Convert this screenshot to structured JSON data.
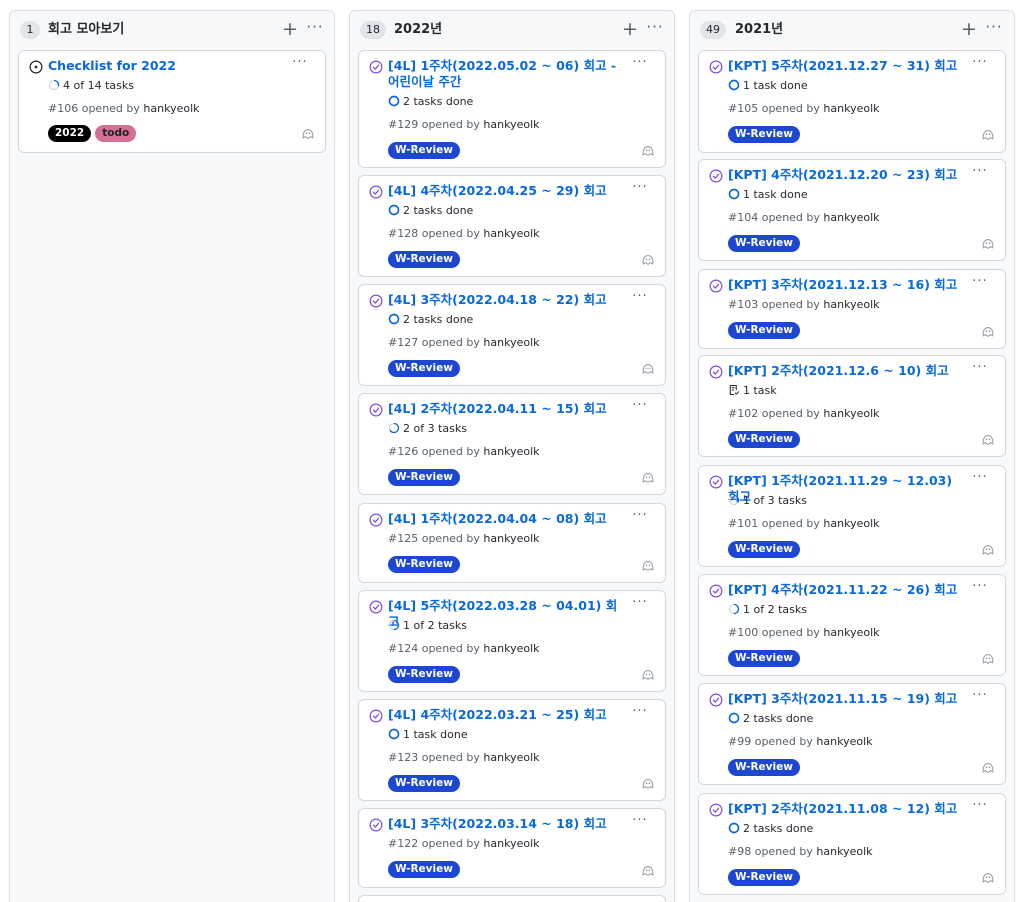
{
  "columns": [
    {
      "count": "1",
      "title": "회고 모아보기",
      "cards": [
        {
          "state": "open",
          "title": "Checklist for 2022",
          "task": "4 of 14 tasks",
          "task_icon": "progress-ring-icon",
          "progress": 0.29,
          "opened": "#106 opened by",
          "author": "hankyeolk",
          "labels": [
            "2022",
            "todo"
          ]
        }
      ]
    },
    {
      "count": "18",
      "title": "2022년",
      "cards": [
        {
          "state": "closed",
          "title": "[4L] 1주차(2022.05.02 ~ 06) 회고 - 어린이날 주간",
          "task": "2 tasks done",
          "task_icon": "done-circle-icon",
          "progress": 1,
          "opened": "#129 opened by",
          "author": "hankyeolk",
          "labels": [
            "W-Review"
          ]
        },
        {
          "state": "closed",
          "title": "[4L] 4주차(2022.04.25 ~ 29) 회고",
          "task": "2 tasks done",
          "task_icon": "done-circle-icon",
          "progress": 1,
          "opened": "#128 opened by",
          "author": "hankyeolk",
          "labels": [
            "W-Review"
          ]
        },
        {
          "state": "closed",
          "title": "[4L] 3주차(2022.04.18 ~ 22) 회고",
          "task": "2 tasks done",
          "task_icon": "done-circle-icon",
          "progress": 1,
          "opened": "#127 opened by",
          "author": "hankyeolk",
          "labels": [
            "W-Review"
          ]
        },
        {
          "state": "closed",
          "title": "[4L] 2주차(2022.04.11 ~ 15) 회고",
          "task": "2 of 3 tasks",
          "task_icon": "progress-ring-icon",
          "progress": 0.67,
          "opened": "#126 opened by",
          "author": "hankyeolk",
          "labels": [
            "W-Review"
          ]
        },
        {
          "state": "closed",
          "title": "[4L] 1주차(2022.04.04 ~ 08) 회고",
          "task": "",
          "task_icon": "",
          "progress": 0,
          "opened": "#125 opened by",
          "author": "hankyeolk",
          "labels": [
            "W-Review"
          ]
        },
        {
          "state": "closed",
          "title": "[4L] 5주차(2022.03.28 ~ 04.01) 회고",
          "task": "1 of 2 tasks",
          "task_icon": "progress-ring-icon",
          "progress": 0.5,
          "opened": "#124 opened by",
          "author": "hankyeolk",
          "labels": [
            "W-Review"
          ]
        },
        {
          "state": "closed",
          "title": "[4L] 4주차(2022.03.21 ~ 25) 회고",
          "task": "1 task done",
          "task_icon": "done-circle-icon",
          "progress": 1,
          "opened": "#123 opened by",
          "author": "hankyeolk",
          "labels": [
            "W-Review"
          ]
        },
        {
          "state": "closed",
          "title": "[4L] 3주차(2022.03.14 ~ 18) 회고",
          "task": "",
          "task_icon": "",
          "progress": 0,
          "opened": "#122 opened by",
          "author": "hankyeolk",
          "labels": [
            "W-Review"
          ]
        }
      ]
    },
    {
      "count": "49",
      "title": "2021년",
      "cards": [
        {
          "state": "closed",
          "title": "[KPT] 5주차(2021.12.27 ~ 31) 회고",
          "task": "1 task done",
          "task_icon": "done-circle-icon",
          "progress": 1,
          "opened": "#105 opened by",
          "author": "hankyeolk",
          "labels": [
            "W-Review"
          ]
        },
        {
          "state": "closed",
          "title": "[KPT] 4주차(2021.12.20 ~ 23) 회고",
          "task": "1 task done",
          "task_icon": "done-circle-icon",
          "progress": 1,
          "opened": "#104 opened by",
          "author": "hankyeolk",
          "labels": [
            "W-Review"
          ]
        },
        {
          "state": "closed",
          "title": "[KPT] 3주차(2021.12.13 ~ 16) 회고",
          "task": "",
          "task_icon": "",
          "progress": 0,
          "opened": "#103 opened by",
          "author": "hankyeolk",
          "labels": [
            "W-Review"
          ]
        },
        {
          "state": "closed",
          "title": "[KPT] 2주차(2021.12.6 ~ 10) 회고",
          "task": "1 task",
          "task_icon": "checklist-icon",
          "progress": 0,
          "opened": "#102 opened by",
          "author": "hankyeolk",
          "labels": [
            "W-Review"
          ]
        },
        {
          "state": "closed",
          "title": "[KPT] 1주차(2021.11.29 ~ 12.03) 회고",
          "task": "1 of 3 tasks",
          "task_icon": "progress-ring-icon",
          "progress": 0.33,
          "opened": "#101 opened by",
          "author": "hankyeolk",
          "labels": [
            "W-Review"
          ]
        },
        {
          "state": "closed",
          "title": "[KPT] 4주차(2021.11.22 ~ 26) 회고",
          "task": "1 of 2 tasks",
          "task_icon": "progress-ring-icon",
          "progress": 0.5,
          "opened": "#100 opened by",
          "author": "hankyeolk",
          "labels": [
            "W-Review"
          ]
        },
        {
          "state": "closed",
          "title": "[KPT] 3주차(2021.11.15 ~ 19) 회고",
          "task": "2 tasks done",
          "task_icon": "done-circle-icon",
          "progress": 1,
          "opened": "#99 opened by",
          "author": "hankyeolk",
          "labels": [
            "W-Review"
          ]
        },
        {
          "state": "closed",
          "title": "[KPT] 2주차(2021.11.08 ~ 12) 회고",
          "task": "2 tasks done",
          "task_icon": "done-circle-icon",
          "progress": 1,
          "opened": "#98 opened by",
          "author": "hankyeolk",
          "labels": [
            "W-Review"
          ]
        }
      ]
    }
  ],
  "actions": {
    "add_icon": "plus-icon",
    "more_icon": "kebab-icon",
    "more_text": "···",
    "card_menu_icon": "kebab-icon",
    "note_icon": "octoface-icon"
  },
  "label_colors": {
    "2022": {
      "bg": "#000000",
      "fg": "#ffffff"
    },
    "todo": {
      "bg": "#d47093",
      "fg": "#1f2328"
    },
    "W-Review": {
      "bg": "#1d46d1",
      "fg": "#ffffff"
    }
  },
  "colors": {
    "link": "#0969da",
    "closed_state": "#8250df",
    "open_state": "#24292f",
    "task_ring": "#0969da"
  }
}
